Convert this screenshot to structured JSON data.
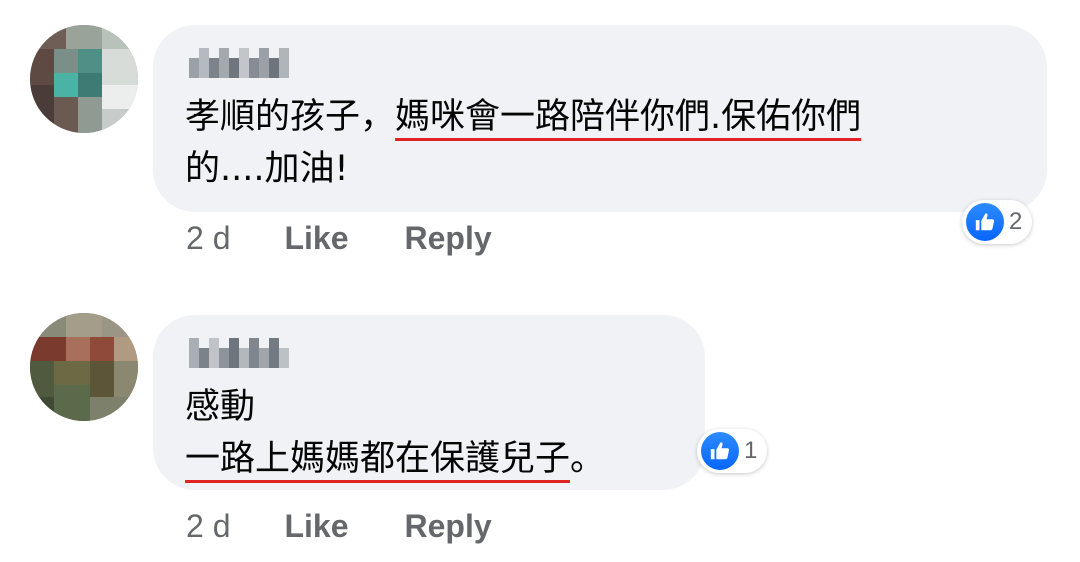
{
  "comments": [
    {
      "author_name": "",
      "text_lines": [
        {
          "plain": "孝順的孩子，",
          "underlined": "媽咪會一路陪伴你們.保佑你們"
        },
        {
          "plain": "的....加油!",
          "underlined": ""
        }
      ],
      "reaction": {
        "icon": "like-icon",
        "count": "2"
      },
      "time": "2 d",
      "like_label": "Like",
      "reply_label": "Reply"
    },
    {
      "author_name": "",
      "text_lines": [
        {
          "plain": "感動",
          "underlined": ""
        },
        {
          "plain": "",
          "underlined": "一路上媽媽都在保護兒子",
          "trailing": "。"
        }
      ],
      "reaction": {
        "icon": "like-icon",
        "count": "1"
      },
      "time": "2 d",
      "like_label": "Like",
      "reply_label": "Reply"
    }
  ],
  "colors": {
    "bubble_bg": "#f0f2f5",
    "text": "#050505",
    "secondary_text": "#65676b",
    "like_blue": "#0866ff",
    "annotation_underline": "#e02424"
  }
}
